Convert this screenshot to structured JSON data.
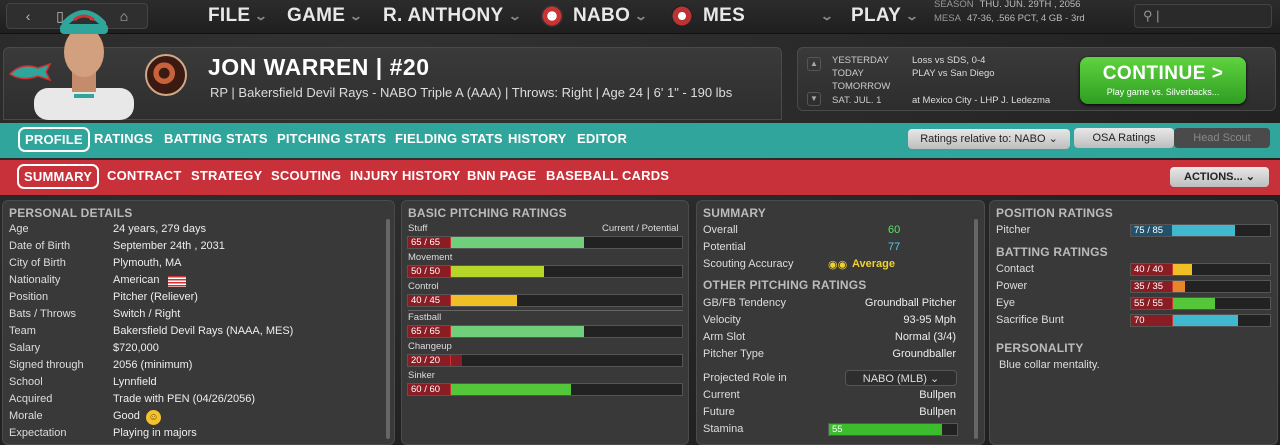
{
  "topbar": {
    "menus": [
      "FILE",
      "GAME",
      "R. ANTHONY",
      "NABO",
      "MES",
      "PLAY"
    ],
    "season_label": "SEASON",
    "season_value": "THU. JUN. 29TH , 2056",
    "team_label": "MESA",
    "team_value": "47-36, .566 PCT, 4 GB - 3rd"
  },
  "player": {
    "name": "JON WARREN",
    "sep": "|",
    "number": "#20",
    "info": "RP  |  Bakersfield Devil Rays - NABO Triple A (AAA)  |  Throws: Right  |  Age 24  |  6' 1\" - 190 lbs"
  },
  "schedule": {
    "rows": [
      {
        "day": "YESTERDAY",
        "text": "Loss vs SDS, 0-4"
      },
      {
        "day": "TODAY",
        "text": "PLAY vs San Diego"
      },
      {
        "day": "TOMORROW",
        "text": ""
      },
      {
        "day": "SAT. JUL. 1",
        "text": "at Mexico City - LHP J. Ledezma"
      }
    ],
    "continue_label": "CONTINUE",
    "continue_icon": ">",
    "continue_sub": "Play game vs. Silverbacks..."
  },
  "tabs1": [
    "PROFILE",
    "RATINGS",
    "BATTING STATS",
    "PITCHING STATS",
    "FIELDING STATS",
    "HISTORY",
    "EDITOR"
  ],
  "tabs1_controls": {
    "relative": "Ratings relative to: NABO",
    "osa": "OSA Ratings",
    "scout": "Head Scout"
  },
  "tabs2": [
    "SUMMARY",
    "CONTRACT",
    "STRATEGY",
    "SCOUTING",
    "INJURY HISTORY",
    "BNN PAGE",
    "BASEBALL CARDS"
  ],
  "actions_label": "ACTIONS...",
  "personal": {
    "title": "PERSONAL DETAILS",
    "rows": [
      [
        "Age",
        "24 years, 279 days"
      ],
      [
        "Date of Birth",
        "September 24th , 2031"
      ],
      [
        "City of Birth",
        "Plymouth, MA"
      ],
      [
        "Nationality",
        "American"
      ],
      [
        "Position",
        "Pitcher (Reliever)"
      ],
      [
        "Bats / Throws",
        "Switch / Right"
      ],
      [
        "Team",
        "Bakersfield Devil Rays (NAAA, MES)"
      ],
      [
        "Salary",
        "$720,000"
      ],
      [
        "Signed through",
        "2056 (minimum)"
      ],
      [
        "School",
        "Lynnfield"
      ],
      [
        "Acquired",
        "Trade with PEN (04/26/2056)"
      ],
      [
        "Morale",
        "Good"
      ],
      [
        "Expectation",
        "Playing in majors"
      ]
    ]
  },
  "pitching": {
    "title": "BASIC PITCHING RATINGS",
    "header": "Current / Potential",
    "bars": [
      {
        "name": "Stuff",
        "label": "65 / 65",
        "pct": 0.65,
        "color": "#6fcf7a"
      },
      {
        "name": "Movement",
        "label": "50 / 50",
        "pct": 0.5,
        "color": "#b6d62a"
      },
      {
        "name": "Control",
        "label": "40 / 45",
        "pct": 0.4,
        "color": "#efc026"
      },
      {
        "name": "Fastball",
        "label": "65 / 65",
        "pct": 0.65,
        "color": "#6fcf7a"
      },
      {
        "name": "Changeup",
        "label": "20 / 20",
        "pct": 0.2,
        "color": "#8a1d24"
      },
      {
        "name": "Sinker",
        "label": "60 / 60",
        "pct": 0.6,
        "color": "#54c63a"
      }
    ]
  },
  "summary": {
    "title": "SUMMARY",
    "overall_label": "Overall",
    "overall": "60",
    "potential_label": "Potential",
    "potential": "77",
    "scout_label": "Scouting Accuracy",
    "scout_value": "Average",
    "other_title": "OTHER PITCHING RATINGS",
    "rows": [
      [
        "GB/FB Tendency",
        "Groundball Pitcher"
      ],
      [
        "Velocity",
        "93-95 Mph"
      ],
      [
        "Arm Slot",
        "Normal (3/4)"
      ],
      [
        "Pitcher Type",
        "Groundballer"
      ]
    ],
    "role_label": "Projected Role in",
    "role_select": "NABO (MLB)",
    "current_label": "Current",
    "current": "Bullpen",
    "future_label": "Future",
    "future": "Bullpen",
    "stamina_label": "Stamina",
    "stamina": "55",
    "stamina_pct": 0.55
  },
  "position": {
    "title": "POSITION RATINGS",
    "pitcher_label": "Pitcher",
    "pitcher": "75 / 85",
    "pitcher_pct": 0.75,
    "batting_title": "BATTING RATINGS",
    "bars": [
      {
        "name": "Contact",
        "label": "40 / 40",
        "pct": 0.4,
        "color": "#efc026"
      },
      {
        "name": "Power",
        "label": "35 / 35",
        "pct": 0.35,
        "color": "#e8842a"
      },
      {
        "name": "Eye",
        "label": "55 / 55",
        "pct": 0.55,
        "color": "#54c63a"
      },
      {
        "name": "Sacrifice Bunt",
        "label": "70",
        "pct": 0.7,
        "color": "#3fb8d0"
      }
    ],
    "personality_title": "PERSONALITY",
    "personality": "Blue collar mentality."
  }
}
